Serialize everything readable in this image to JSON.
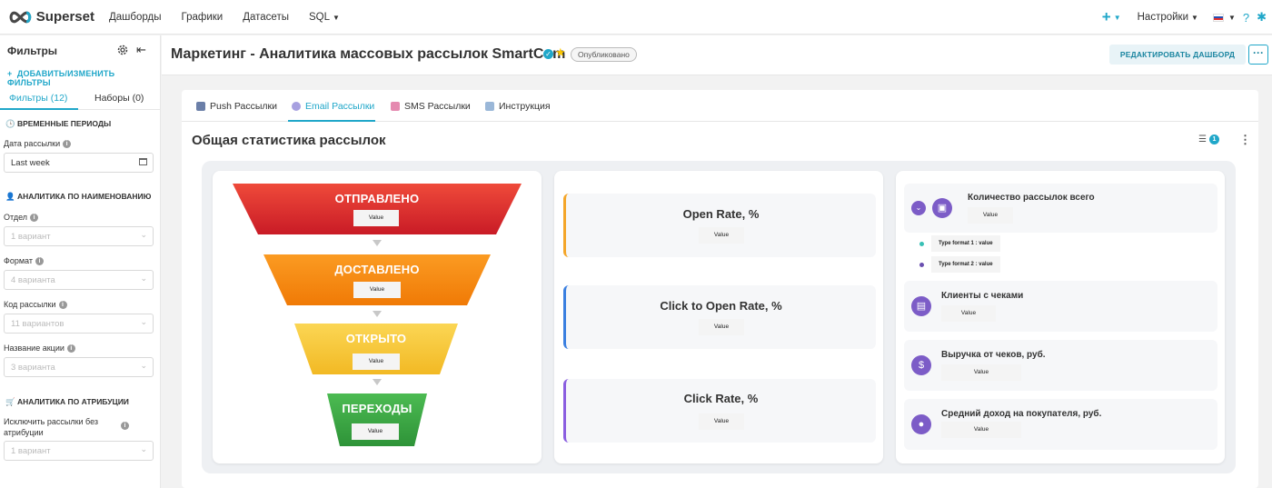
{
  "topnav": {
    "brand": "Superset",
    "menu": [
      {
        "label": "Дашборды"
      },
      {
        "label": "Графики"
      },
      {
        "label": "Датасеты"
      },
      {
        "label": "SQL"
      }
    ],
    "plus": "+",
    "settings": "Настройки",
    "help": "?",
    "accent_color": "#20a7c9"
  },
  "filters": {
    "title": "Фильтры",
    "add_edit": "ДОБАВИТЬ/ИЗМЕНИТЬ ФИЛЬТРЫ",
    "tab_filters": "Фильтры (12)",
    "tab_sets": "Наборы (0)",
    "sections": {
      "time": "ВРЕМЕННЫЕ ПЕРИОДЫ",
      "by_name": "АНАЛИТИКА ПО НАИМЕНОВАНИЮ",
      "attribution": "АНАЛИТИКА ПО АТРИБУЦИИ"
    },
    "fields": {
      "date_label": "Дата рассылки",
      "date_value": "Last week",
      "dept_label": "Отдел",
      "dept_ph": "1 вариант",
      "format_label": "Формат",
      "format_ph": "4 варианта",
      "code_label": "Код рассылки",
      "code_ph": "11 вариантов",
      "action_label": "Название акции",
      "action_ph": "3 варианта",
      "exclude_label": "Исключить рассылки без атрибуции",
      "exclude_ph": "1 вариант"
    }
  },
  "dashboard": {
    "title": "Маркетинг - Аналитика массовых рассылок SmartCom",
    "status": "Опубликовано",
    "edit_button": "РЕДАКТИРОВАТЬ ДАШБОРД",
    "more": "···",
    "tabs": [
      {
        "label": "Push Рассылки"
      },
      {
        "label": "Email Рассылки"
      },
      {
        "label": "SMS Рассылки"
      },
      {
        "label": "Инструкция"
      }
    ],
    "active_tab": "Email Рассылки",
    "section_title": "Общая статистика рассылок",
    "filter_count": "1"
  },
  "funnel": [
    {
      "label": "ОТПРАВЛЕНО",
      "value": "Value",
      "color": "#e02d2d"
    },
    {
      "label": "ДОСТАВЛЕНО",
      "value": "Value",
      "color": "#f98a10"
    },
    {
      "label": "ОТКРЫТО",
      "value": "Value",
      "color": "#f9cb40"
    },
    {
      "label": "ПЕРЕХОДЫ",
      "value": "Value",
      "color": "#3daa46"
    }
  ],
  "rates": [
    {
      "title": "Open Rate, %",
      "value": "Value",
      "color": "#f4a62a"
    },
    {
      "title": "Click to Open Rate, %",
      "value": "Value",
      "color": "#3a7fe0"
    },
    {
      "title": "Click Rate, %",
      "value": "Value",
      "color": "#8a5ee0"
    }
  ],
  "kpis": {
    "total": {
      "title": "Количество рассылок всего",
      "value": "Value",
      "icon": "box-icon"
    },
    "types": [
      {
        "label": "Type format 1 : value",
        "color": "#38c0b5"
      },
      {
        "label": "Type format 2 : value",
        "color": "#6a4fb0"
      }
    ],
    "clients": {
      "title": "Клиенты с чеками",
      "value": "Value",
      "icon": "receipt-icon"
    },
    "revenue": {
      "title": "Выручка от чеков, руб.",
      "value": "Value",
      "icon": "money-bag-icon"
    },
    "avg": {
      "title": "Средний доход на покупателя, руб.",
      "value": "Value",
      "icon": "person-icon"
    }
  }
}
